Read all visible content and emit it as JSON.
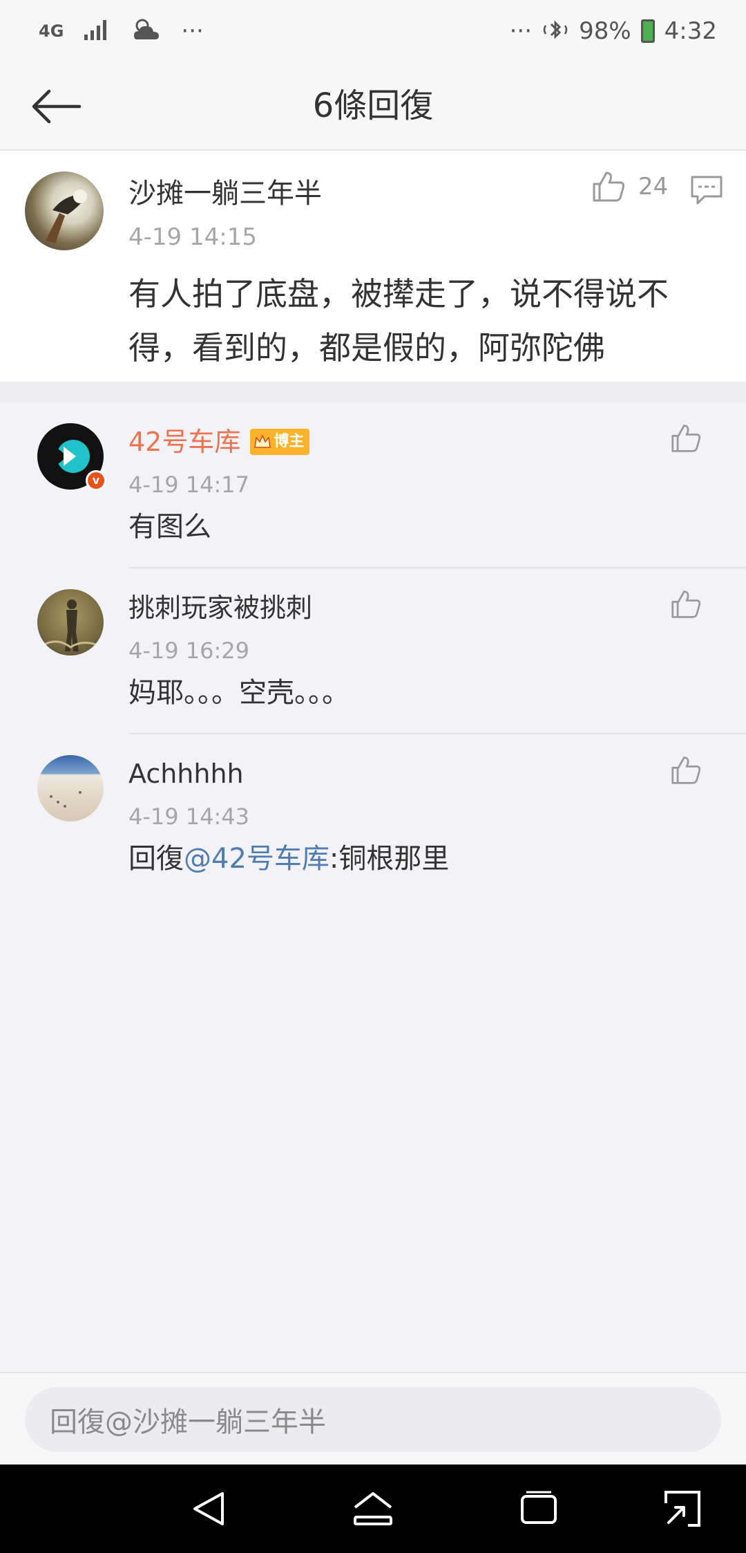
{
  "status_bar": {
    "network": "4G",
    "more_left": "···",
    "more_right": "···",
    "battery": "98%",
    "time": "4:32"
  },
  "header": {
    "title": "6條回復"
  },
  "root_comment": {
    "user": "沙摊一躺三年半",
    "time": "4-19 14:15",
    "likes": "24",
    "text": "有人拍了底盘，被撵走了，说不得说不得，看到的，都是假的，阿弥陀佛"
  },
  "replies": [
    {
      "user": "42号车库",
      "badge": "博主",
      "time": "4-19 14:17",
      "text": "有图么"
    },
    {
      "user": "挑刺玩家被挑刺",
      "time": "4-19 16:29",
      "text": "妈耶。。。空壳。。。"
    },
    {
      "user": "Achhhhh",
      "time": "4-19 14:43",
      "reply_prefix": "回復",
      "mention": "@42号车库",
      "reply_text": ":铜根那里"
    }
  ],
  "input": {
    "placeholder": "回復@沙摊一躺三年半"
  },
  "colors": {
    "vip_name": "#eb7350",
    "mention": "#507daf",
    "badge": "#fab32a",
    "background": "#f3f3f7"
  }
}
